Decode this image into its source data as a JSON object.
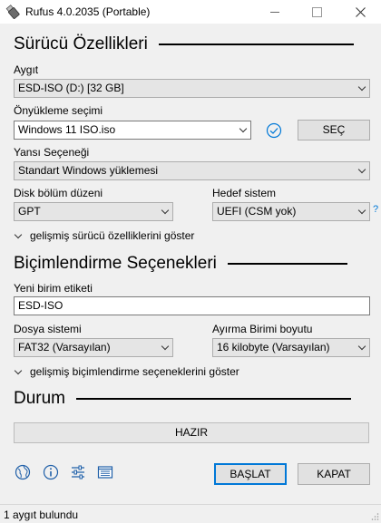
{
  "window": {
    "title": "Rufus 4.0.2035 (Portable)",
    "accent": "#0078d7"
  },
  "drive_properties": {
    "section_title": "Sürücü Özellikleri",
    "device_label": "Aygıt",
    "device_value": "ESD-ISO (D:) [32 GB]",
    "boot_selection_label": "Önyükleme seçimi",
    "boot_selection_value": "Windows 11 ISO.iso",
    "select_button": "SEÇ",
    "image_option_label": "Yansı Seçeneği",
    "image_option_value": "Standart Windows yüklemesi",
    "partition_scheme_label": "Disk bölüm düzeni",
    "partition_scheme_value": "GPT",
    "target_system_label": "Hedef sistem",
    "target_system_value": "UEFI (CSM yok)",
    "help_mark": "?",
    "advanced_toggle": "gelişmiş sürücü özelliklerini göster"
  },
  "format_options": {
    "section_title": "Biçimlendirme Seçenekleri",
    "volume_label_label": "Yeni birim etiketi",
    "volume_label_value": "ESD-ISO",
    "file_system_label": "Dosya sistemi",
    "file_system_value": "FAT32 (Varsayılan)",
    "cluster_size_label": "Ayırma Birimi boyutu",
    "cluster_size_value": "16 kilobyte (Varsayılan)",
    "advanced_toggle": "gelişmiş biçimlendirme seçeneklerini göster"
  },
  "status": {
    "section_title": "Durum",
    "progress_text": "HAZIR",
    "progress_fraction": 0
  },
  "toolbar": {
    "icons": [
      "globe-icon",
      "info-icon",
      "settings-sliders-icon",
      "log-icon"
    ],
    "start_button": "BAŞLAT",
    "close_button": "KAPAT"
  },
  "statusbar": {
    "text": "1 aygıt bulundu"
  }
}
